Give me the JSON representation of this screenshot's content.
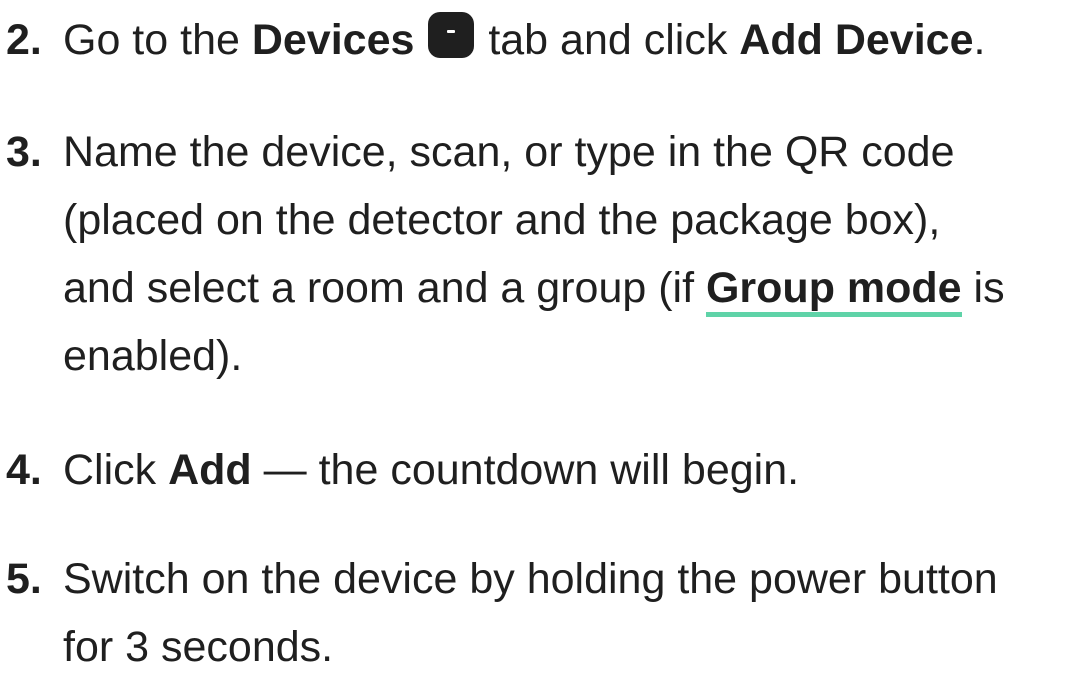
{
  "steps": [
    {
      "number": "2.",
      "lines": [
        [
          "Go to the ",
          {
            "bold": "Devices"
          },
          {
            "icon": "devices-tab-icon"
          },
          " tab and click ",
          {
            "bold": "Add Device"
          },
          "."
        ]
      ]
    },
    {
      "number": "3.",
      "text_line1": "Name the device, scan, or type in the QR code",
      "text_line2": "(placed on the detector and the package box),",
      "text_line3_before": "and select a room and a group (if ",
      "text_line3_link": "Group mode",
      "text_line3_after": " is",
      "text_line4": "enabled)."
    },
    {
      "number": "4.",
      "before": "Click ",
      "bold": "Add",
      "after": " — the countdown will begin."
    },
    {
      "number": "5.",
      "text_line1": "Switch on the device by holding the power button",
      "text_line2": "for 3 seconds."
    }
  ],
  "step2": {
    "number": "2.",
    "before": "Go to the ",
    "bold1": "Devices",
    "middle": " tab and click ",
    "bold2": "Add Device",
    "after": "."
  },
  "icons": {
    "devices_tab": "devices-tab-icon"
  },
  "colors": {
    "text": "#1f1f1f",
    "link_underline": "#5fd3a8",
    "background": "#ffffff"
  }
}
